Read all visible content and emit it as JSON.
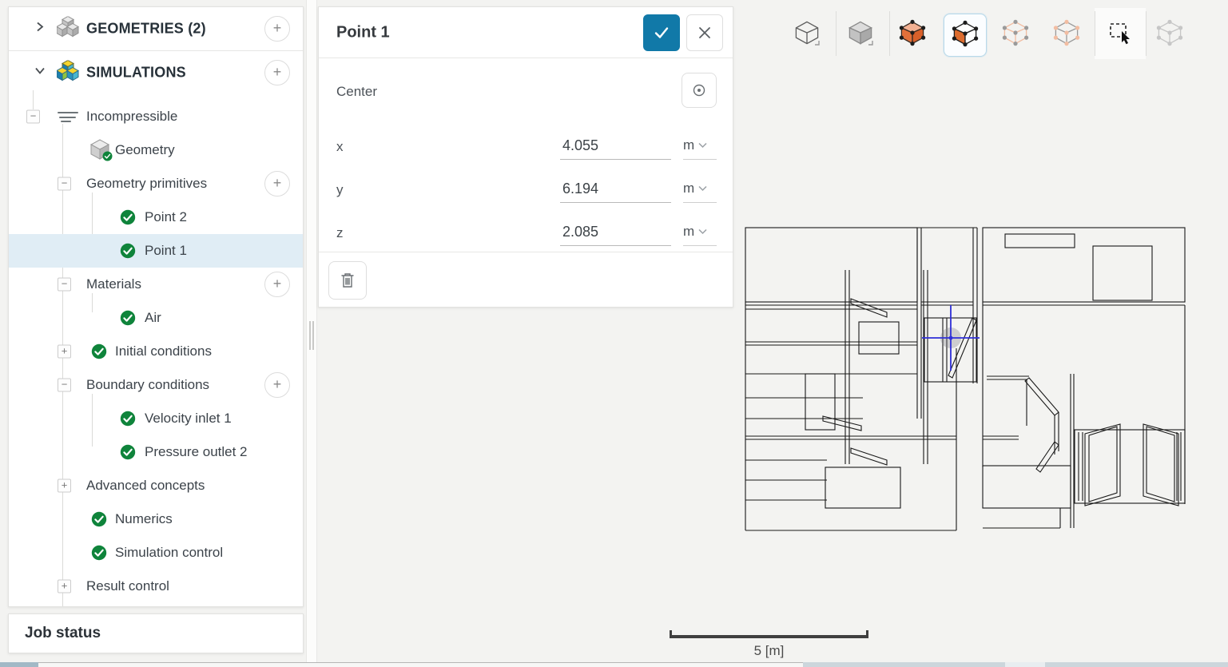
{
  "colors": {
    "accent_blue": "#1179a8",
    "accent_orange": "#e2703a",
    "success_green": "#0f843b",
    "selection_background": "#e0edf5",
    "canvas_background": "#f3f3f1",
    "crosshair_blue": "#2f2fd8"
  },
  "sidebar": {
    "sections": [
      {
        "label": "GEOMETRIES (2)",
        "chevron": "right",
        "icon": "geometries-cubes-icon",
        "add_button": true
      },
      {
        "label": "SIMULATIONS",
        "chevron": "down",
        "icon": "simulations-cubes-icon",
        "add_button": true
      }
    ],
    "tree": [
      {
        "label": "Incompressible",
        "variant": "sim-root",
        "expander": "minus",
        "icon": "simulation-icon",
        "add": false,
        "check": false,
        "selected": false
      },
      {
        "label": "Geometry",
        "variant": "geometry",
        "expander": null,
        "icon": "geometry-cube-icon",
        "add": false,
        "check": false,
        "selected": false
      },
      {
        "label": "Geometry primitives",
        "variant": "group",
        "expander": "minus",
        "icon": null,
        "add": true,
        "check": false,
        "selected": false
      },
      {
        "label": "Point 2",
        "variant": "leaf2",
        "expander": null,
        "icon": null,
        "add": false,
        "check": true,
        "selected": false
      },
      {
        "label": "Point 1",
        "variant": "leaf2",
        "expander": null,
        "icon": null,
        "add": false,
        "check": true,
        "selected": true
      },
      {
        "label": "Materials",
        "variant": "group",
        "expander": "minus",
        "icon": null,
        "add": true,
        "check": false,
        "selected": false
      },
      {
        "label": "Air",
        "variant": "leaf2",
        "expander": null,
        "icon": null,
        "add": false,
        "check": true,
        "selected": false
      },
      {
        "label": "Initial conditions",
        "variant": "leaf1",
        "expander": "plus",
        "icon": null,
        "add": false,
        "check": true,
        "selected": false
      },
      {
        "label": "Boundary conditions",
        "variant": "group",
        "expander": "minus",
        "icon": null,
        "add": true,
        "check": false,
        "selected": false
      },
      {
        "label": "Velocity inlet 1",
        "variant": "leaf2",
        "expander": null,
        "icon": null,
        "add": false,
        "check": true,
        "selected": false
      },
      {
        "label": "Pressure outlet 2",
        "variant": "leaf2",
        "expander": null,
        "icon": null,
        "add": false,
        "check": true,
        "selected": false
      },
      {
        "label": "Advanced concepts",
        "variant": "group",
        "expander": "plus",
        "icon": null,
        "add": false,
        "check": false,
        "selected": false
      },
      {
        "label": "Numerics",
        "variant": "leaf1",
        "expander": null,
        "icon": null,
        "add": false,
        "check": true,
        "selected": false
      },
      {
        "label": "Simulation control",
        "variant": "leaf1",
        "expander": null,
        "icon": null,
        "add": false,
        "check": true,
        "selected": false
      },
      {
        "label": "Result control",
        "variant": "group",
        "expander": "plus",
        "icon": null,
        "add": false,
        "check": false,
        "selected": false
      }
    ],
    "add_button_label": "+",
    "job_status_label": "Job status"
  },
  "detail_panel": {
    "title": "Point 1",
    "confirm_icon": "check-icon",
    "close_icon": "close-icon",
    "section_label": "Center",
    "pick_icon": "target-icon",
    "delete_icon": "trash-icon",
    "fields": [
      {
        "label": "x",
        "value": "4.055",
        "unit": "m"
      },
      {
        "label": "y",
        "value": "6.194",
        "unit": "m"
      },
      {
        "label": "z",
        "value": "2.085",
        "unit": "m"
      }
    ]
  },
  "toolbar": {
    "items": [
      {
        "name": "wireframe-view-button",
        "state": "normal",
        "glyph": "cube-outline",
        "corner": true
      },
      {
        "name": "solid-view-button",
        "state": "normal",
        "glyph": "cube-solid",
        "corner": true
      },
      {
        "name": "volume-select-button",
        "state": "normal",
        "glyph": "cube-volume-dots",
        "corner": false
      },
      {
        "name": "face-select-button",
        "state": "active",
        "glyph": "cube-face-dots",
        "corner": false
      },
      {
        "name": "edge-select-button",
        "state": "disabled",
        "glyph": "cube-wire-orange-edges",
        "corner": false
      },
      {
        "name": "vertex-select-button",
        "state": "disabled",
        "glyph": "cube-wire-orange-dots",
        "corner": false
      },
      {
        "name": "box-select-button",
        "state": "normal",
        "glyph": "marquee-cursor",
        "corner": false
      },
      {
        "name": "hidden-select-button",
        "state": "disabled",
        "glyph": "cube-wire-grey",
        "corner": false
      }
    ]
  },
  "viewport": {
    "scale_bar_label": "5 [m]",
    "marker": {
      "x": "4.055",
      "y": "6.194",
      "z": "2.085"
    }
  }
}
